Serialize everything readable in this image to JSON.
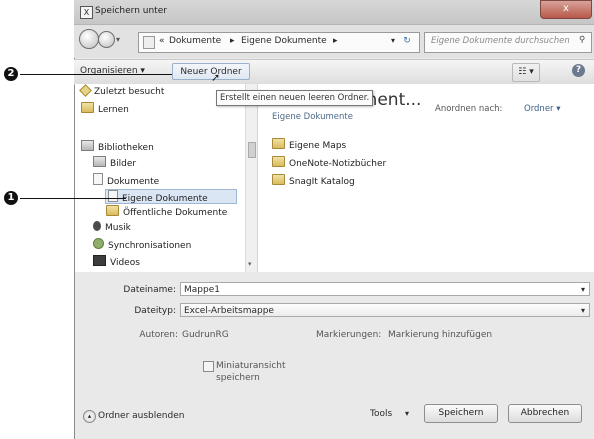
{
  "window": {
    "title": "Speichern unter",
    "icon_label": "X",
    "close_label": "x"
  },
  "nav": {
    "breadcrumb": [
      "«",
      "Dokumente",
      "▸",
      "Eigene Dokumente",
      "▸"
    ],
    "search_placeholder": "Eigene Dokumente durchsuchen"
  },
  "toolbar": {
    "organize_label": "Organisieren ▾",
    "new_folder_label": "Neuer Ordner",
    "view_label": "☷ ▾",
    "help_label": "?"
  },
  "tooltip": "Erstellt einen neuen leeren Ordner.",
  "sidebar": {
    "items": [
      {
        "label": "Zuletzt besucht",
        "icon": "recent-icon"
      },
      {
        "label": "Lernen",
        "icon": "folder-icon"
      },
      {
        "label": "Bibliotheken",
        "icon": "library-icon"
      },
      {
        "label": "Bilder",
        "icon": "pictures-icon"
      },
      {
        "label": "Dokumente",
        "icon": "documents-icon"
      },
      {
        "label": "Eigene Dokumente",
        "icon": "folder-icon"
      },
      {
        "label": "Öffentliche Dokumente",
        "icon": "folder-icon"
      },
      {
        "label": "Musik",
        "icon": "music-icon"
      },
      {
        "label": "Synchronisationen",
        "icon": "sync-icon"
      },
      {
        "label": "Videos",
        "icon": "video-icon"
      }
    ]
  },
  "content": {
    "header_title": "ument...",
    "header_subtitle": "Eigene Dokumente",
    "arrange_label": "Anordnen nach:",
    "arrange_value": "Ordner ▾",
    "files": [
      "Eigene Maps",
      "OneNote-Notizbücher",
      "SnagIt Katalog"
    ]
  },
  "form": {
    "filename_label": "Dateiname:",
    "filename_value": "Mappe1",
    "filetype_label": "Dateityp:",
    "filetype_value": "Excel-Arbeitsmappe",
    "authors_label": "Autoren:",
    "authors_value": "GudrunRG",
    "tags_label": "Markierungen:",
    "tags_value": "Markierung hinzufügen",
    "thumbnail_label_1": "Miniaturansicht",
    "thumbnail_label_2": "speichern"
  },
  "footer": {
    "hide_folders_label": "Ordner ausblenden",
    "tools_label": "Tools",
    "save_label": "Speichern",
    "cancel_label": "Abbrechen"
  },
  "callouts": {
    "one": "1",
    "two": "2"
  }
}
